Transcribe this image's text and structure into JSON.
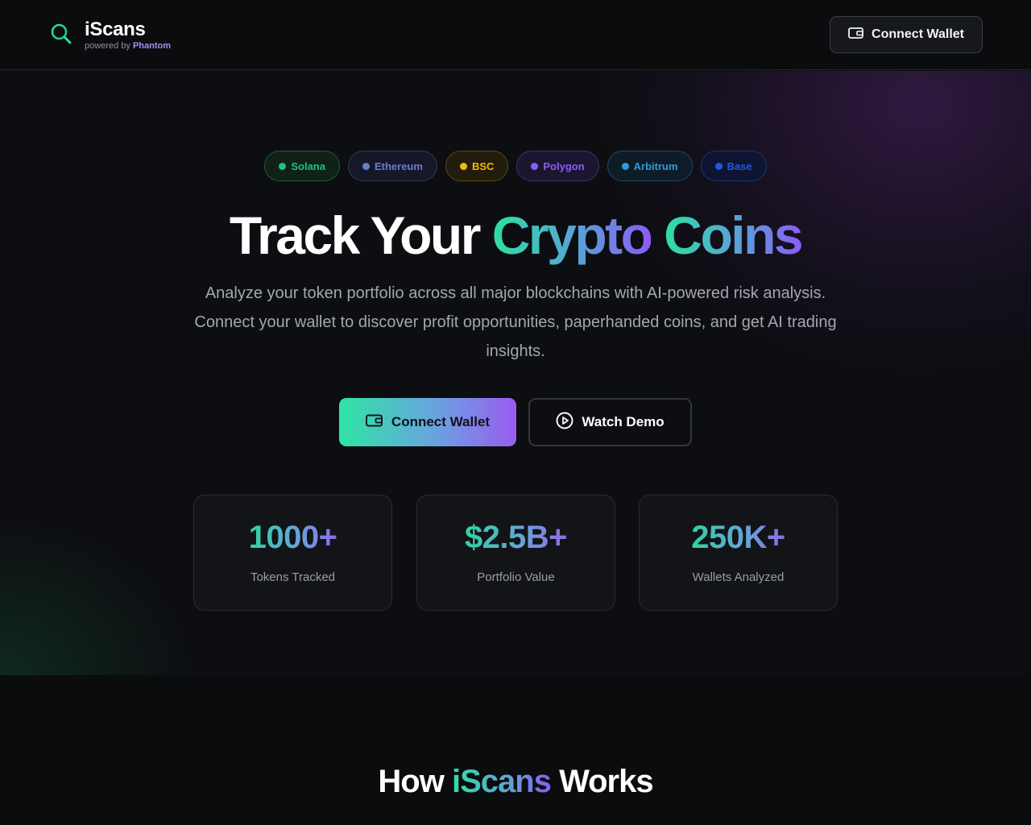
{
  "header": {
    "brand_name": "iScans",
    "powered_by": "powered by",
    "powered_by_brand": "Phantom",
    "connect_button": "Connect Wallet"
  },
  "chains": [
    {
      "label": "Solana",
      "color": "#22c27a",
      "border": "#1f5a40",
      "bg": "#0f2119"
    },
    {
      "label": "Ethereum",
      "color": "#6b7cc7",
      "border": "#363a52",
      "bg": "#16182a"
    },
    {
      "label": "BSC",
      "color": "#f0b90b",
      "border": "#5a4a15",
      "bg": "#221c0b"
    },
    {
      "label": "Polygon",
      "color": "#8b5cf6",
      "border": "#43306b",
      "bg": "#1c1530"
    },
    {
      "label": "Arbitrum",
      "color": "#2d9cdb",
      "border": "#1f4a64",
      "bg": "#0e1c28"
    },
    {
      "label": "Base",
      "color": "#2056e8",
      "border": "#1f336e",
      "bg": "#0d1532"
    }
  ],
  "hero": {
    "title_plain": "Track Your",
    "title_grad_1": "Crypto",
    "title_grad_2": "Coins",
    "description": "Analyze your token portfolio across all major blockchains with AI-powered risk analysis. Connect your wallet to discover profit opportunities, paperhanded coins, and get AI trading insights.",
    "primary_cta": "Connect Wallet",
    "secondary_cta": "Watch Demo"
  },
  "stats": [
    {
      "value": "1000+",
      "label": "Tokens Tracked"
    },
    {
      "value": "$2.5B+",
      "label": "Portfolio Value"
    },
    {
      "value": "250K+",
      "label": "Wallets Analyzed"
    }
  ],
  "how": {
    "prefix": "How",
    "brand": "iScans",
    "suffix": "Works"
  },
  "icons": {
    "logo": "search-icon",
    "wallet": "wallet-icon",
    "play": "play-circle-icon"
  }
}
